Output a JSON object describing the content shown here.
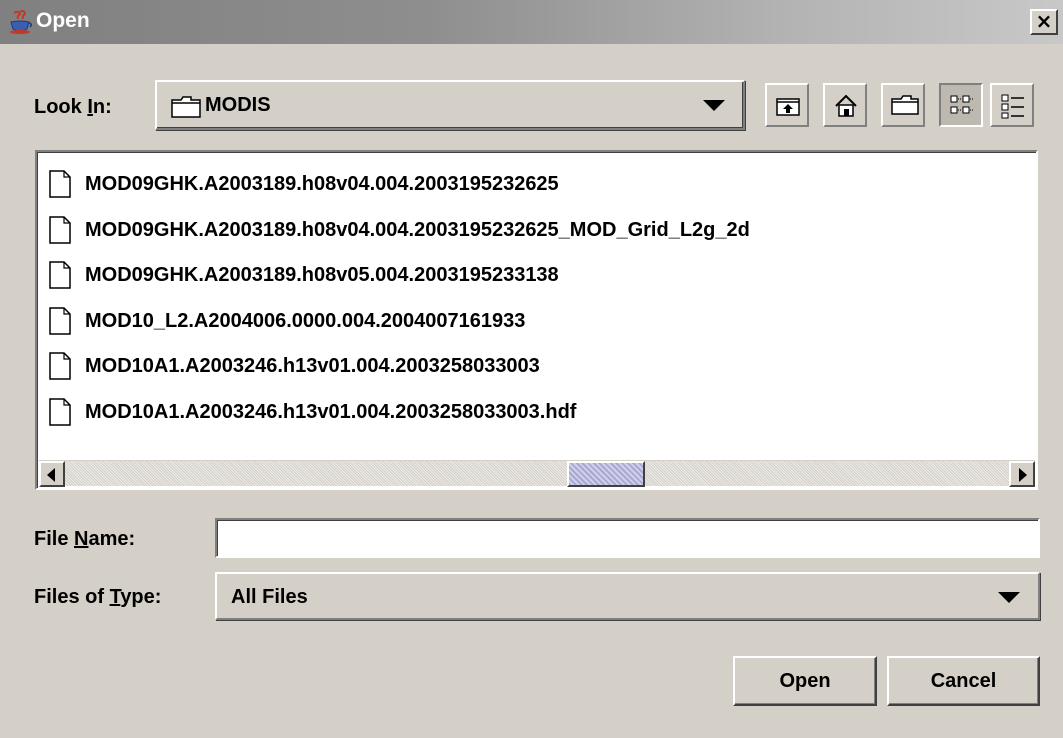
{
  "window": {
    "title": "Open"
  },
  "toolbar": {
    "look_in_label_pre": "Look ",
    "look_in_label_mn": "I",
    "look_in_label_post": "n:",
    "look_in_value": "MODIS",
    "buttons": [
      "up-one-level-icon",
      "home-icon",
      "new-folder-icon",
      "list-view-icon",
      "details-view-icon"
    ],
    "active_view": "list"
  },
  "file_list": {
    "items": [
      "MOD09GHK.A2003189.h08v04.004.2003195232625",
      "MOD09GHK.A2003189.h08v04.004.2003195232625_MOD_Grid_L2g_2d",
      "MOD09GHK.A2003189.h08v05.004.2003195233138",
      "MOD10_L2.A2004006.0000.004.2004007161933",
      "MOD10A1.A2003246.h13v01.004.2003258033003",
      "MOD10A1.A2003246.h13v01.004.2003258033003.hdf"
    ],
    "scroll_position": 0.58
  },
  "file_name": {
    "label_pre": "File ",
    "label_mn": "N",
    "label_post": "ame:",
    "value": ""
  },
  "file_type": {
    "label_pre": "Files of ",
    "label_mn": "T",
    "label_post": "ype:",
    "value": "All Files"
  },
  "buttons": {
    "open": "Open",
    "cancel": "Cancel"
  },
  "colors": {
    "face": "#d4d0c8",
    "title_start": "#808080",
    "title_end": "#c8c8c8",
    "thumb": "#b8b8d8"
  }
}
